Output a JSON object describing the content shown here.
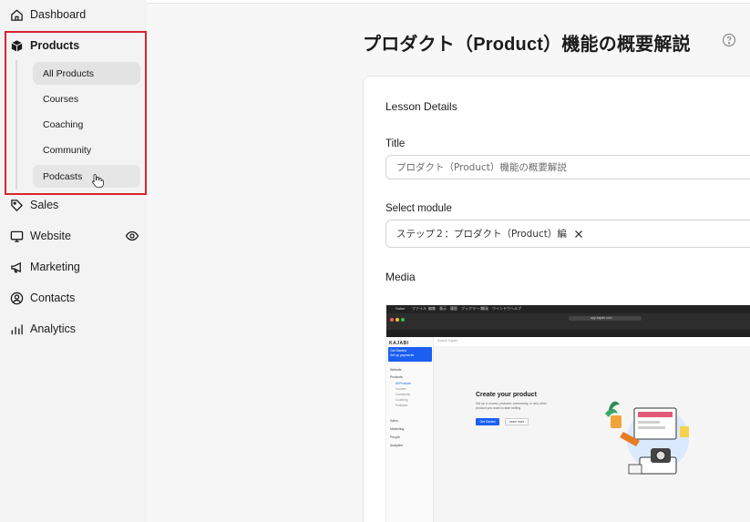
{
  "sidebar": {
    "items": [
      {
        "label": "Dashboard",
        "icon": "home-icon"
      },
      {
        "label": "Products",
        "icon": "box-icon"
      },
      {
        "label": "Sales",
        "icon": "tag-icon"
      },
      {
        "label": "Website",
        "icon": "monitor-icon"
      },
      {
        "label": "Marketing",
        "icon": "megaphone-icon"
      },
      {
        "label": "Contacts",
        "icon": "user-circle-icon"
      },
      {
        "label": "Analytics",
        "icon": "bar-chart-icon"
      }
    ],
    "products_sub": [
      "All Products",
      "Courses",
      "Coaching",
      "Community",
      "Podcasts"
    ],
    "active_sub": "All Products",
    "highlight_color": "#d9232e"
  },
  "main": {
    "title": "プロダクト（Product）機能の概要解説",
    "card": {
      "section_title": "Lesson Details",
      "title_label": "Title",
      "title_value": "プロダクト（Product）機能の概要解説",
      "module_label": "Select module",
      "module_value": "ステップ２：プロダクト（Product）編",
      "media_label": "Media"
    }
  },
  "media_preview": {
    "menubar": [
      "Safari",
      "ファイル",
      "編集",
      "表示",
      "履歴",
      "ブックマーク",
      "開発",
      "ウインドウ",
      "ヘルプ"
    ],
    "url": "app.kajabi.com",
    "logo": "KAJABI",
    "banner_lines": [
      "Get Started",
      "Set up payments"
    ],
    "search_placeholder": "Search Kajabi...",
    "side_items": [
      "Website",
      "Products",
      "Sales",
      "Marketing",
      "People",
      "Analytics"
    ],
    "side_sub": [
      "All Products",
      "Courses",
      "Community",
      "Coaching",
      "Podcasts"
    ],
    "headline": "Create your product",
    "subtext": "Set up a course, podcast, community, or any other product you want to start selling.",
    "primary_button": "Get Started",
    "secondary_button": "Learn more",
    "brand_color": "#1a5ff0"
  }
}
